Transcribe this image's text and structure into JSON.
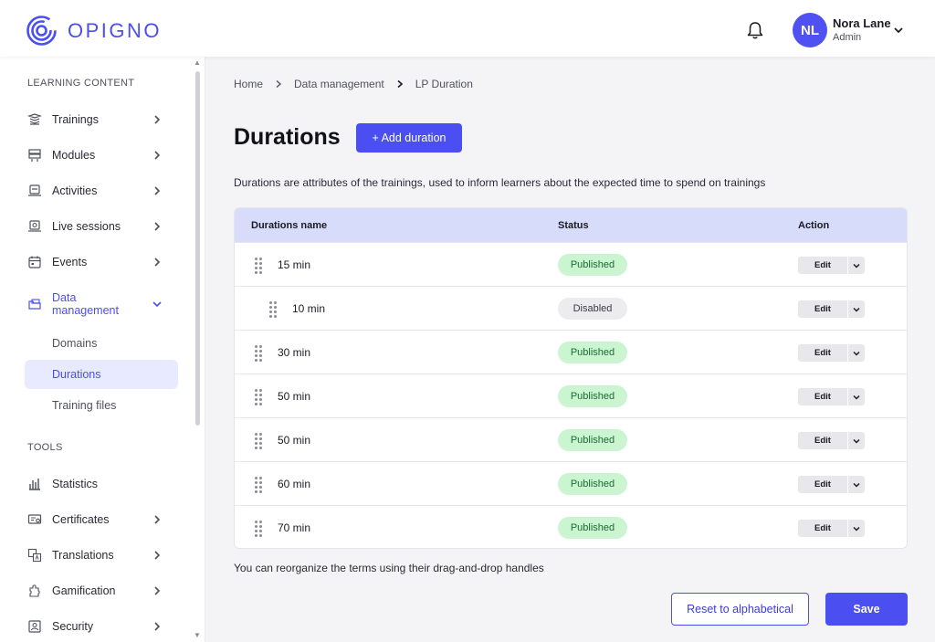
{
  "header": {
    "logo_text": "OPIGNO",
    "user": {
      "initials": "NL",
      "name": "Nora Lane",
      "role": "Admin"
    },
    "icons": [
      "logo-icon",
      "bell-icon",
      "chevron-down-icon"
    ]
  },
  "sidebar": {
    "section_learning": "LEARNING CONTENT",
    "section_tools": "TOOLS",
    "learning_items": [
      {
        "label": "Trainings",
        "icon": "trainings-icon"
      },
      {
        "label": "Modules",
        "icon": "modules-icon"
      },
      {
        "label": "Activities",
        "icon": "activities-icon"
      },
      {
        "label": "Live sessions",
        "icon": "live-sessions-icon"
      },
      {
        "label": "Events",
        "icon": "calendar-icon"
      },
      {
        "label": "Data management",
        "label_line1": "Data",
        "label_line2": "management",
        "icon": "data-management-icon"
      }
    ],
    "sub_items": [
      {
        "label": "Domains"
      },
      {
        "label": "Durations"
      },
      {
        "label": "Training files"
      }
    ],
    "tool_items": [
      {
        "label": "Statistics",
        "icon": "statistics-icon"
      },
      {
        "label": "Certificates",
        "icon": "certificates-icon"
      },
      {
        "label": "Translations",
        "icon": "translations-icon"
      },
      {
        "label": "Gamification",
        "icon": "gamification-icon"
      },
      {
        "label": "Security",
        "icon": "security-icon"
      }
    ]
  },
  "breadcrumb": [
    "Home",
    "Data management",
    "LP Duration"
  ],
  "main": {
    "title": "Durations",
    "add_button": "+ Add duration",
    "description": "Durations are attributes of the trainings, used to inform learners about the expected time to spend on trainings",
    "table": {
      "headers": {
        "name": "Durations name",
        "status": "Status",
        "action": "Action"
      },
      "rows": [
        {
          "name": "15 min",
          "status": "Published",
          "action": "Edit"
        },
        {
          "name": "10 min",
          "status": "Disabled",
          "action": "Edit"
        },
        {
          "name": "30 min",
          "status": "Published",
          "action": "Edit"
        },
        {
          "name": "50 min",
          "status": "Published",
          "action": "Edit"
        },
        {
          "name": "50 min",
          "status": "Published",
          "action": "Edit"
        },
        {
          "name": "60 min",
          "status": "Published",
          "action": "Edit"
        },
        {
          "name": "70 min",
          "status": "Published",
          "action": "Edit"
        }
      ]
    },
    "hint": "You can reorganize the terms using their drag-and-drop handles",
    "reset_button": "Reset to alphabetical",
    "save_button": "Save"
  },
  "colors": {
    "accent": "#4b4ef1",
    "header_row": "#d7dcfb",
    "published_bg": "#cbf5d1",
    "disabled_bg": "#ececef",
    "active_item_bg": "#e8eaff"
  }
}
